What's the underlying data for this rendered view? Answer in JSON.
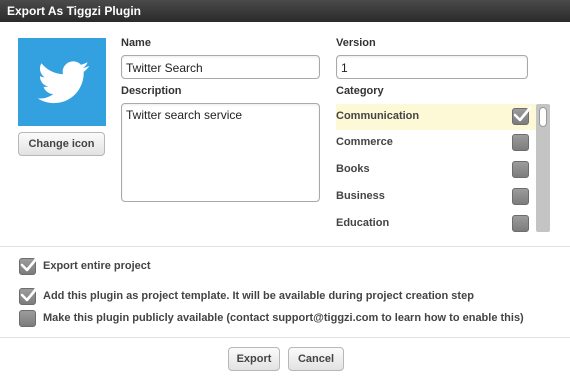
{
  "window": {
    "title": "Export As Tiggzi Plugin"
  },
  "icon": {
    "name": "twitter-bird-icon",
    "background": "#33a1e0",
    "change_label": "Change icon"
  },
  "fields": {
    "name": {
      "label": "Name",
      "value": "Twitter Search"
    },
    "description": {
      "label": "Description",
      "value": "Twitter search service"
    },
    "version": {
      "label": "Version",
      "value": "1"
    }
  },
  "category": {
    "label": "Category",
    "items": [
      {
        "label": "Communication",
        "checked": true,
        "selected": true
      },
      {
        "label": "Commerce",
        "checked": false,
        "selected": false
      },
      {
        "label": "Books",
        "checked": false,
        "selected": false
      },
      {
        "label": "Business",
        "checked": false,
        "selected": false
      },
      {
        "label": "Education",
        "checked": false,
        "selected": false
      }
    ],
    "highlight_color": "#fdf8d6"
  },
  "options": [
    {
      "label": "Export entire project",
      "checked": true
    },
    {
      "label": "Add this plugin as project template. It will be available during project creation step",
      "checked": true
    },
    {
      "label": "Make this plugin publicly available (contact support@tiggzi.com to learn how to enable this)",
      "checked": false
    }
  ],
  "buttons": {
    "export": "Export",
    "cancel": "Cancel"
  }
}
